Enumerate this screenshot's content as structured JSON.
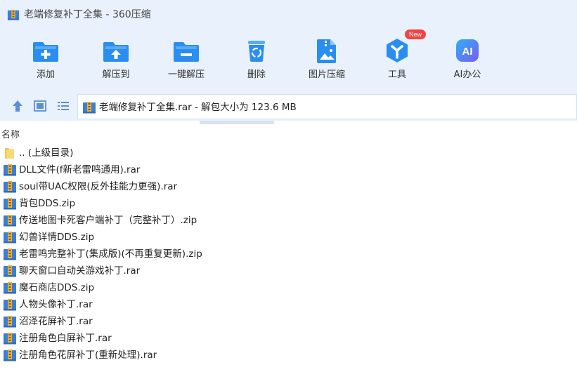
{
  "window": {
    "title": "老端修复补丁全集 - 360压缩"
  },
  "toolbar": {
    "buttons": [
      {
        "label": "添加",
        "icon": "add-icon"
      },
      {
        "label": "解压到",
        "icon": "extract-to-icon"
      },
      {
        "label": "一键解压",
        "icon": "one-click-extract-icon"
      },
      {
        "label": "删除",
        "icon": "delete-icon"
      },
      {
        "label": "图片压缩",
        "icon": "image-compress-icon"
      },
      {
        "label": "工具",
        "icon": "tools-icon",
        "badge": "New"
      },
      {
        "label": "AI办公",
        "icon": "ai-office-icon",
        "icon_text": "AI"
      }
    ]
  },
  "nav": {
    "path_text": "老端修复补丁全集.rar - 解包大小为 123.6 MB"
  },
  "columns": {
    "name": "名称"
  },
  "files": [
    {
      "name": ".. (上级目录)",
      "type": "folder"
    },
    {
      "name": "DLL文件(f新老雷鸣通用).rar",
      "type": "archive"
    },
    {
      "name": "soul带UAC权限(反外挂能力更强).rar",
      "type": "archive"
    },
    {
      "name": "背包DDS.zip",
      "type": "archive"
    },
    {
      "name": "传送地图卡死客户端补丁（完整补丁）.zip",
      "type": "archive"
    },
    {
      "name": "幻兽详情DDS.zip",
      "type": "archive"
    },
    {
      "name": "老雷鸣完整补丁(集成版)(不再重复更新).zip",
      "type": "archive"
    },
    {
      "name": "聊天窗口自动关游戏补丁.rar",
      "type": "archive"
    },
    {
      "name": "魔石商店DDS.zip",
      "type": "archive"
    },
    {
      "name": "人物头像补丁.rar",
      "type": "archive"
    },
    {
      "name": "沼泽花屏补丁.rar",
      "type": "archive"
    },
    {
      "name": "注册角色白屏补丁.rar",
      "type": "archive"
    },
    {
      "name": "注册角色花屏补丁(重新处理).rar",
      "type": "archive"
    }
  ],
  "colors": {
    "toolbar_bg": "#e8f1fc",
    "icon_blue": "#2a8ef0",
    "badge_red": "#f04444",
    "ai_gradient_start": "#2fb0f5",
    "ai_gradient_end": "#7a5cf0"
  }
}
